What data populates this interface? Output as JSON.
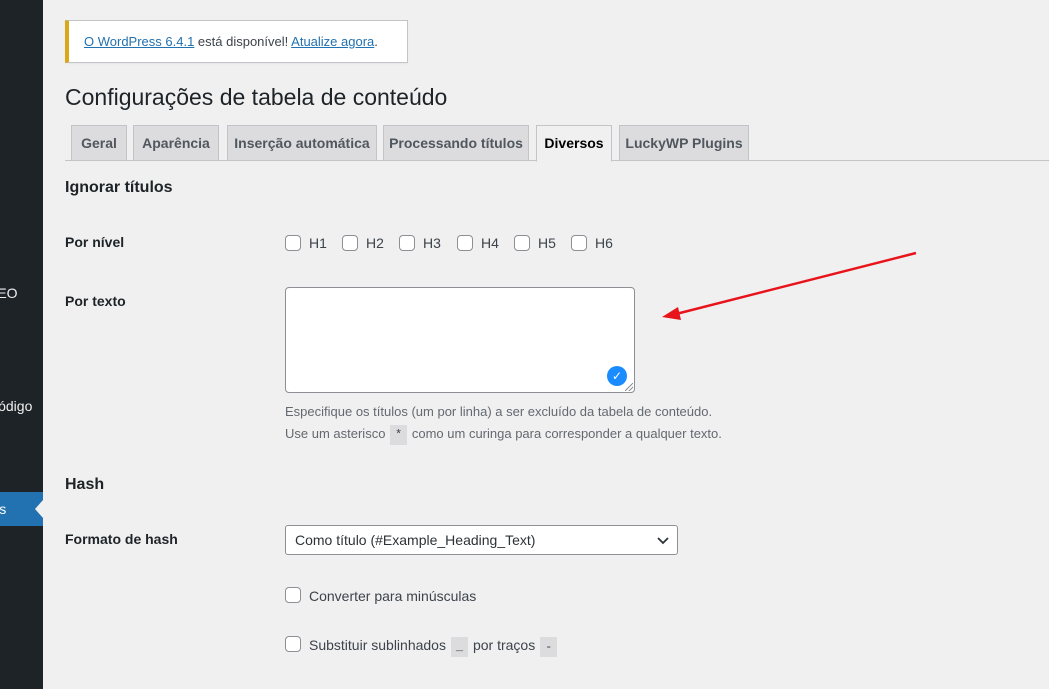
{
  "sidebar": {
    "items": [
      {
        "label": "SEO"
      },
      {
        "label": "Código"
      },
      {
        "label": "Opções",
        "active": true
      }
    ]
  },
  "notice": {
    "link1": "O WordPress 6.4.1",
    "middle": " está disponível! ",
    "link2": "Atualize agora",
    "end": "."
  },
  "page_title": "Configurações de tabela de conteúdo",
  "tabs": [
    {
      "label": "Geral"
    },
    {
      "label": "Aparência"
    },
    {
      "label": "Inserção automática"
    },
    {
      "label": "Processando títulos"
    },
    {
      "label": "Diversos",
      "active": true
    },
    {
      "label": "LuckyWP Plugins"
    }
  ],
  "ignore_section": {
    "title": "Ignorar títulos",
    "by_level_label": "Por nível",
    "levels": [
      "H1",
      "H2",
      "H3",
      "H4",
      "H5",
      "H6"
    ],
    "by_text_label": "Por texto",
    "textarea_value": "",
    "desc_line1": "Especifique os títulos (um por linha) a ser excluído da tabela de conteúdo.",
    "desc_line2_a": "Use um asterisco",
    "desc_line2_code": "*",
    "desc_line2_b": "como um curinga para corresponder a qualquer texto."
  },
  "hash_section": {
    "title": "Hash",
    "format_label": "Formato de hash",
    "format_value": "Como título (#Example_Heading_Text)",
    "lowercase_label": "Converter para minúsculas",
    "replace_label_a": "Substituir sublinhados",
    "replace_code1": "_",
    "replace_label_b": "por traços",
    "replace_code2": "-"
  },
  "colors": {
    "accent": "#2271b1",
    "notice_border": "#dba617",
    "annotation_arrow": "#e8141b",
    "badge": "#1a8cff"
  }
}
